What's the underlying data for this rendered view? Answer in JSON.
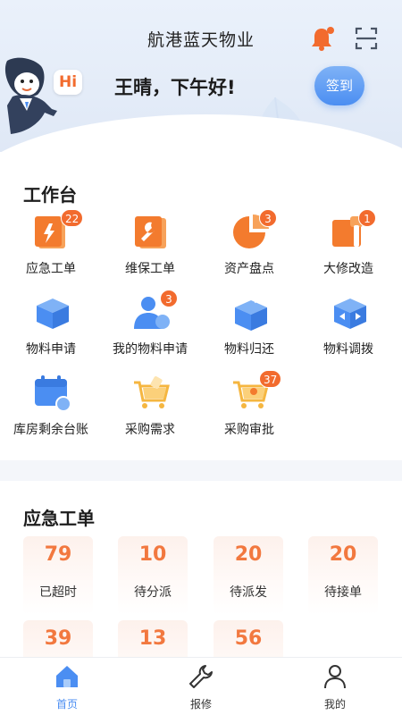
{
  "header": {
    "app_title": "航港蓝天物业",
    "hi_label": "Hi",
    "greeting": "王晴，下午好!",
    "checkin_label": "签到"
  },
  "workbench": {
    "title": "工作台",
    "items": [
      {
        "label": "应急工单",
        "badge": "22",
        "icon": "emergency-order-icon"
      },
      {
        "label": "维保工单",
        "badge": "",
        "icon": "maintenance-order-icon"
      },
      {
        "label": "资产盘点",
        "badge": "3",
        "icon": "asset-inventory-icon"
      },
      {
        "label": "大修改造",
        "badge": "1",
        "icon": "major-repair-icon"
      },
      {
        "label": "物料申请",
        "badge": "",
        "icon": "material-request-icon"
      },
      {
        "label": "我的物料申请",
        "badge": "3",
        "icon": "my-material-request-icon"
      },
      {
        "label": "物料归还",
        "badge": "",
        "icon": "material-return-icon"
      },
      {
        "label": "物料调拨",
        "badge": "",
        "icon": "material-transfer-icon"
      },
      {
        "label": "库房剩余台账",
        "badge": "",
        "icon": "warehouse-ledger-icon"
      },
      {
        "label": "采购需求",
        "badge": "",
        "icon": "purchase-demand-icon"
      },
      {
        "label": "采购审批",
        "badge": "37",
        "icon": "purchase-approval-icon"
      }
    ]
  },
  "emergency": {
    "title": "应急工单",
    "stats": [
      {
        "value": "79",
        "label": "已超时"
      },
      {
        "value": "10",
        "label": "待分派"
      },
      {
        "value": "20",
        "label": "待派发"
      },
      {
        "value": "20",
        "label": "待接单"
      },
      {
        "value": "39",
        "label": ""
      },
      {
        "value": "13",
        "label": ""
      },
      {
        "value": "56",
        "label": ""
      }
    ]
  },
  "tabbar": {
    "tabs": [
      {
        "label": "首页",
        "icon": "home-icon",
        "active": true
      },
      {
        "label": "报修",
        "icon": "wrench-icon",
        "active": false
      },
      {
        "label": "我的",
        "icon": "user-icon",
        "active": false
      }
    ]
  },
  "colors": {
    "accent_orange": "#f26b2e",
    "accent_blue": "#4b8ef2",
    "stat_number": "#f2783f"
  }
}
